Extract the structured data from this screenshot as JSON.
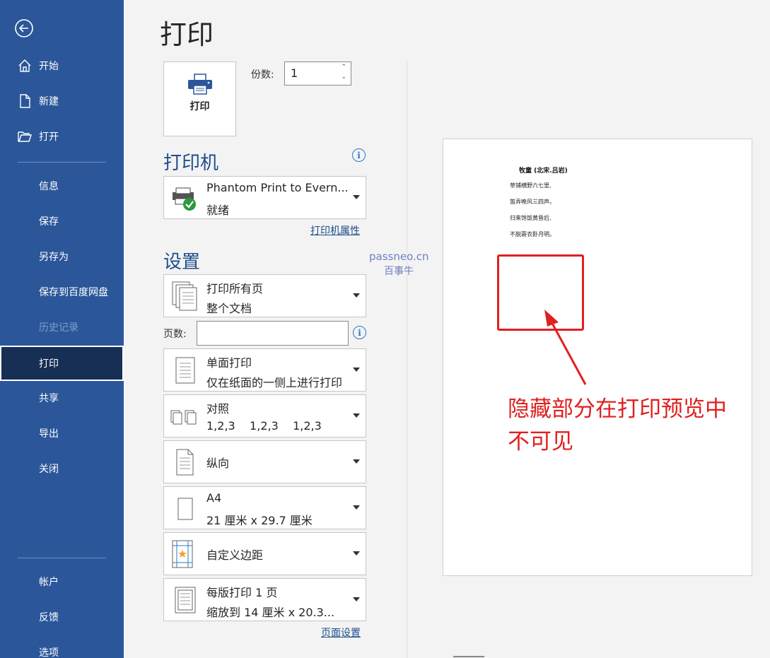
{
  "sidebar": {
    "items": [
      {
        "label": "开始"
      },
      {
        "label": "新建"
      },
      {
        "label": "打开"
      },
      {
        "label": "信息"
      },
      {
        "label": "保存"
      },
      {
        "label": "另存为"
      },
      {
        "label": "保存到百度网盘"
      },
      {
        "label": "历史记录"
      },
      {
        "label": "打印"
      },
      {
        "label": "共享"
      },
      {
        "label": "导出"
      },
      {
        "label": "关闭"
      },
      {
        "label": "帐户"
      },
      {
        "label": "反馈"
      },
      {
        "label": "选项"
      }
    ]
  },
  "main": {
    "title": "打印",
    "print_button": "打印",
    "copies_label": "份数:",
    "copies_value": "1"
  },
  "printer": {
    "heading": "打印机",
    "name": "Phantom Print to Evern...",
    "status": "就绪",
    "properties_link": "打印机属性"
  },
  "settings": {
    "heading": "设置",
    "pages_label": "页数:",
    "page_setup_link": "页面设置",
    "dropdowns": [
      {
        "line1": "打印所有页",
        "line2": "整个文档"
      },
      {
        "line1": "单面打印",
        "line2": "仅在纸面的一侧上进行打印"
      },
      {
        "line1": "对照",
        "line2": "1,2,3    1,2,3    1,2,3"
      },
      {
        "line1": "纵向",
        "line2": ""
      },
      {
        "line1": "A4",
        "line2": "21 厘米 x 29.7 厘米"
      },
      {
        "line1": "自定义边距",
        "line2": ""
      },
      {
        "line1": "每版打印 1 页",
        "line2": "缩放到 14 厘米 x 20.3..."
      }
    ]
  },
  "watermark": {
    "line1": "passneo.cn",
    "line2": "百事牛"
  },
  "preview": {
    "poem_title": "牧童  (北宋.吕岩)",
    "poem_lines": [
      "草铺横野六七里,",
      "笛弄晚风三四声。",
      "归来饱饭黄昏后,",
      "不脱蓑衣卧月明。"
    ],
    "annotation": "隐藏部分在打印预览中不可见"
  },
  "colors": {
    "sidebar": "#2b579a",
    "active": "#172f55",
    "accent": "#1e4e8c",
    "annotation": "#e02020"
  }
}
